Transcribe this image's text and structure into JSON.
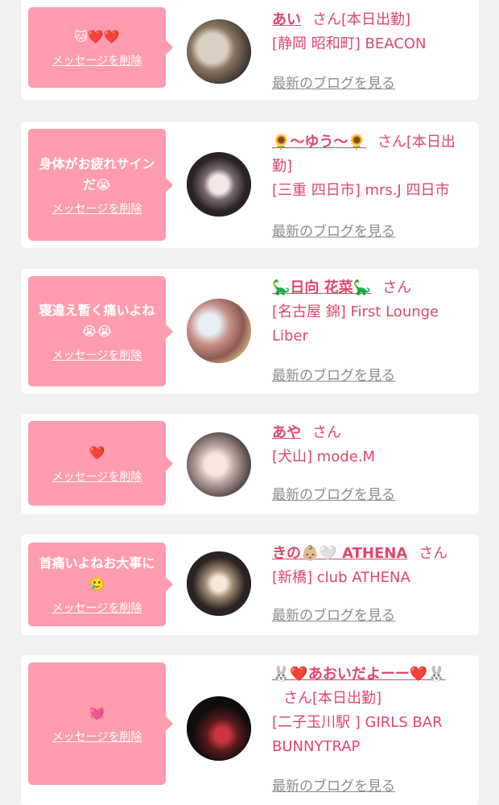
{
  "colors": {
    "bubble": "#ff9cad",
    "accent": "#e0466a",
    "link_gray": "#8c8c8c",
    "card": "#ffffff",
    "background": "#f1f1f1"
  },
  "honorific": "さん",
  "delete_label": "メッセージを削除",
  "blog_label": "最新のブログを見る",
  "cards": [
    {
      "message": "🐱❤️❤️",
      "name": "あい",
      "status": "[本日出勤]",
      "location": "[静岡 昭和町] BEACON"
    },
    {
      "message": "身体がお疲れサインだ😭",
      "name": "🌻〜ゆう〜🌻",
      "status": "[本日出勤]",
      "location": "[三重 四日市] mrs.J 四日市"
    },
    {
      "message": "寝違え暫く痛いよね😭😭",
      "name": "🦕日向 花菜🦕",
      "status": "",
      "location": "[名古屋 錦] First Lounge Liber"
    },
    {
      "message": "❤️",
      "name": "あや",
      "status": "",
      "location": "[犬山] mode.M"
    },
    {
      "message": "首痛いよねお大事に🥲",
      "name": "きの👶🏼🤍 ATHENA",
      "status": "",
      "location": "[新橋] club ATHENA"
    },
    {
      "message": "💓",
      "name": "🐰❤️あおいだよーー❤️🐰",
      "status": "[本日出勤]",
      "location": "[二子玉川駅 ] GIRLS BAR BUNNYTRAP"
    }
  ]
}
